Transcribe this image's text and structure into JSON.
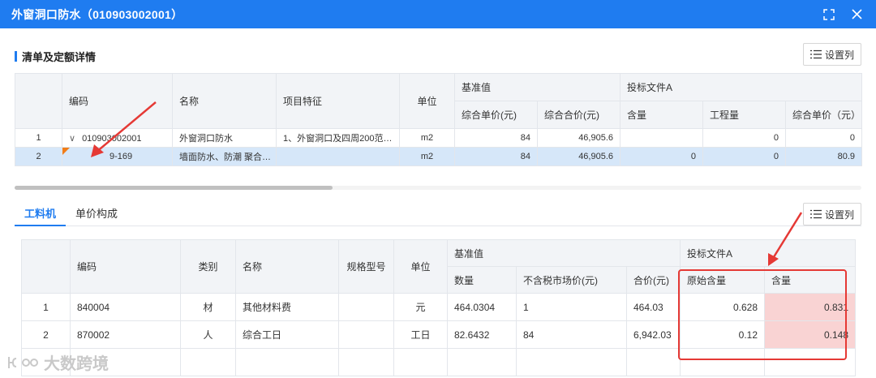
{
  "window": {
    "title": "外窗洞口防水（010903002001）",
    "maximize_icon": "expand-icon",
    "close_icon": "close-icon",
    "accent_color": "#1f7cf0"
  },
  "section": {
    "title": "清单及定额详情",
    "setcol_label": "设置列"
  },
  "top_table": {
    "headers": {
      "code": "编码",
      "name": "名称",
      "feature": "项目特征",
      "unit": "单位",
      "group_base": "基准值",
      "group_bid": "投标文件A",
      "unit_price": "综合单价(元)",
      "total_price": "综合合价(元)",
      "content": "含量",
      "quantity": "工程量",
      "bid_unit_price": "综合单价（元）"
    },
    "rows": [
      {
        "idx": "1",
        "toggle": "∨",
        "code": "010903002001",
        "name": "外窗洞口防水",
        "feature": "1、外窗洞口及四周200范…",
        "unit": "m2",
        "unit_price": "84",
        "total_price": "46,905.6",
        "content": "",
        "quantity": "0",
        "bid_unit_price": "0"
      },
      {
        "idx": "2",
        "toggle": "",
        "code": "9-169",
        "name": "墙面防水、防潮 聚合…",
        "feature": "",
        "unit": "m2",
        "unit_price": "84",
        "total_price": "46,905.6",
        "content": "0",
        "quantity": "0",
        "bid_unit_price": "80.9"
      }
    ]
  },
  "tabs": {
    "items": [
      {
        "label": "工料机"
      },
      {
        "label": "单价构成"
      }
    ],
    "setcol_label": "设置列"
  },
  "bottom_table": {
    "headers": {
      "code": "编码",
      "category": "类别",
      "name": "名称",
      "spec": "规格型号",
      "unit": "单位",
      "group_base": "基准值",
      "group_bid": "投标文件A",
      "qty": "数量",
      "market_price": "不含税市场价(元)",
      "total": "合价(元)",
      "orig_content": "原始含量",
      "content": "含量"
    },
    "rows": [
      {
        "idx": "1",
        "code": "840004",
        "category": "材",
        "name": "其他材料费",
        "spec": "",
        "unit": "元",
        "qty": "464.0304",
        "market_price": "1",
        "total": "464.03",
        "orig_content": "0.628",
        "content": "0.831"
      },
      {
        "idx": "2",
        "code": "870002",
        "category": "人",
        "name": "综合工日",
        "spec": "",
        "unit": "工日",
        "qty": "82.6432",
        "market_price": "84",
        "total": "6,942.03",
        "orig_content": "0.12",
        "content": "0.148"
      }
    ]
  },
  "watermark": {
    "text": "大数跨境"
  },
  "colors": {
    "highlight_red": "#e53935",
    "selected_row": "#d6e7f9",
    "pink_cell": "#f9d3d3",
    "flag_orange": "#f07d19"
  }
}
